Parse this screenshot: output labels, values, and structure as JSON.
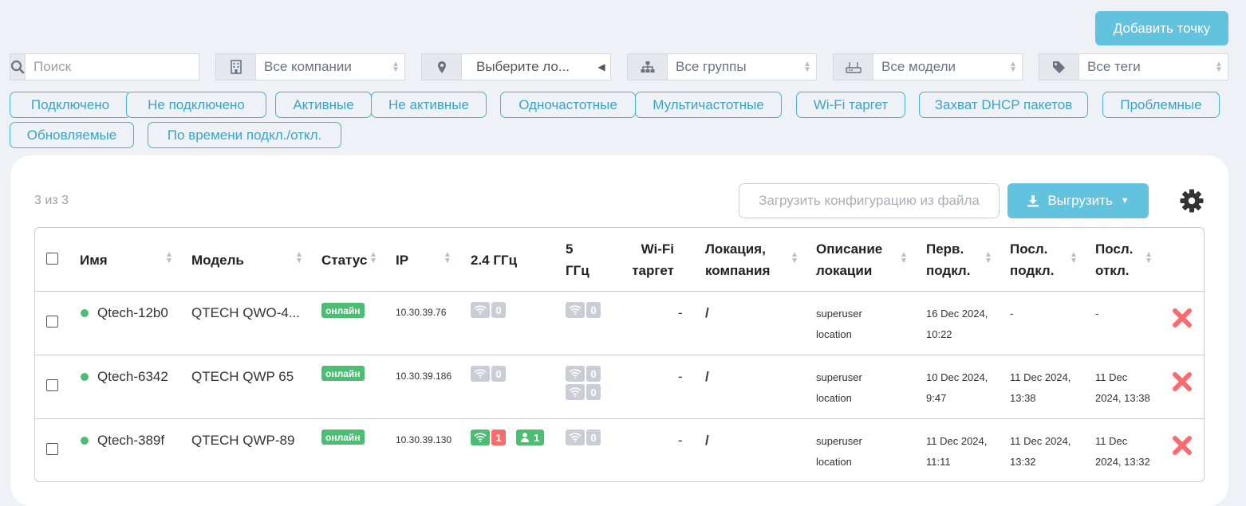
{
  "add_button": "Добавить точку",
  "filters": {
    "search_placeholder": "Поиск",
    "companies": "Все компании",
    "location": "Выберите ло...",
    "groups": "Все группы",
    "models": "Все модели",
    "tags": "Все теги"
  },
  "chips": [
    "Подключено",
    "Не подключено",
    "Активные",
    "Не активные",
    "Одночастотные",
    "Мультичастотные",
    "Wi-Fi таргет",
    "Захват DHCP пакетов",
    "Проблемные",
    "Обновляемые",
    "По времени подкл./откл."
  ],
  "count": "3 из 3",
  "upload_config": "Загрузить конфигурацию из файла",
  "export": "Выгрузить",
  "columns": {
    "name": "Имя",
    "model": "Модель",
    "status": "Статус",
    "ip": "IP",
    "band24": "2.4 ГГц",
    "band5_1": "5",
    "band5_2": "ГГц",
    "wifi_target_1": "Wi-Fi",
    "wifi_target_2": "таргет",
    "location_1": "Локация,",
    "location_2": "компания",
    "desc_1": "Описание",
    "desc_2": "локации",
    "first_1": "Перв.",
    "first_2": "подкл.",
    "last_conn_1": "Посл.",
    "last_conn_2": "подкл.",
    "last_disc_1": "Посл.",
    "last_disc_2": "откл."
  },
  "rows": [
    {
      "name": "Qtech-12b0",
      "model": "QTECH QWO-4...",
      "status": "онлайн",
      "ip": "10.30.39.76",
      "band24": "0",
      "band5": [
        "0"
      ],
      "wifi_target": "-",
      "location": "/",
      "desc_1": "superuser",
      "desc_2": "location",
      "first_1": "16 Dec 2024,",
      "first_2": "10:22",
      "last_conn_1": "-",
      "last_conn_2": "",
      "last_disc_1": "-",
      "last_disc_2": ""
    },
    {
      "name": "Qtech-6342",
      "model": "QTECH QWP 65",
      "status": "онлайн",
      "ip": "10.30.39.186",
      "band24": "0",
      "band5": [
        "0",
        "0"
      ],
      "wifi_target": "-",
      "location": "/",
      "desc_1": "superuser",
      "desc_2": "location",
      "first_1": "10 Dec 2024,",
      "first_2": "9:47",
      "last_conn_1": "11 Dec 2024,",
      "last_conn_2": "13:38",
      "last_disc_1": "11 Dec",
      "last_disc_2": "2024, 13:38"
    },
    {
      "name": "Qtech-389f",
      "model": "QTECH QWP-89",
      "status": "онлайн",
      "ip": "10.30.39.130",
      "band24": "1",
      "band24_clients": "1",
      "band5": [
        "0"
      ],
      "wifi_target": "-",
      "location": "/",
      "desc_1": "superuser",
      "desc_2": "location",
      "first_1": "11 Dec 2024,",
      "first_2": "11:11",
      "last_conn_1": "11 Dec 2024,",
      "last_conn_2": "13:32",
      "last_disc_1": "11 Dec",
      "last_disc_2": "2024, 13:32"
    }
  ],
  "colors": {
    "accent": "#63c2de",
    "chip": "#47b2cf",
    "online": "#4dbd74",
    "danger": "#f86c6b"
  }
}
